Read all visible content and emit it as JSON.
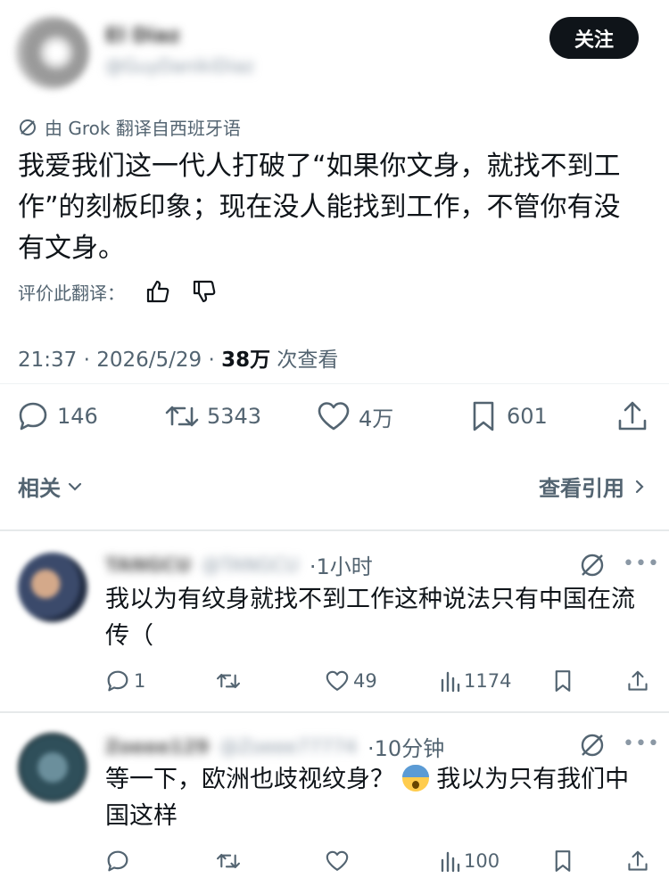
{
  "post": {
    "author_name": "El Diaz",
    "author_handle": "@GuyDanikiDiaz",
    "follow_label": "关注",
    "translated_note": "由 Grok 翻译自西班牙语",
    "text": "我爱我们这一代人打破了“如果你文身，就找不到工作”的刻板印象；现在没人能找到工作，不管你有没有文身。",
    "rate_label": "评价此翻译：",
    "time": "21:37 · 2026/5/29 · ",
    "views": "38万",
    "views_label": " 次查看",
    "replies": "146",
    "reposts": "5343",
    "likes": "4万",
    "bookmarks": "601",
    "related_label": "相关",
    "quotes_label": "查看引用"
  },
  "replies": [
    {
      "name": "TANGCU",
      "handle": "@TANGCU",
      "time": "·1小时",
      "text": "我以为有纹身就找不到工作这种说法只有中国在流传（",
      "replies": "1",
      "likes": "49",
      "views": "1174"
    },
    {
      "name": "Zoeee129",
      "handle": "@Zoeee77774",
      "time": "·10分钟",
      "text_before": "等一下，欧洲也歧视纹身？",
      "text_after": "我以为只有我们中国这样",
      "views": "100"
    }
  ]
}
